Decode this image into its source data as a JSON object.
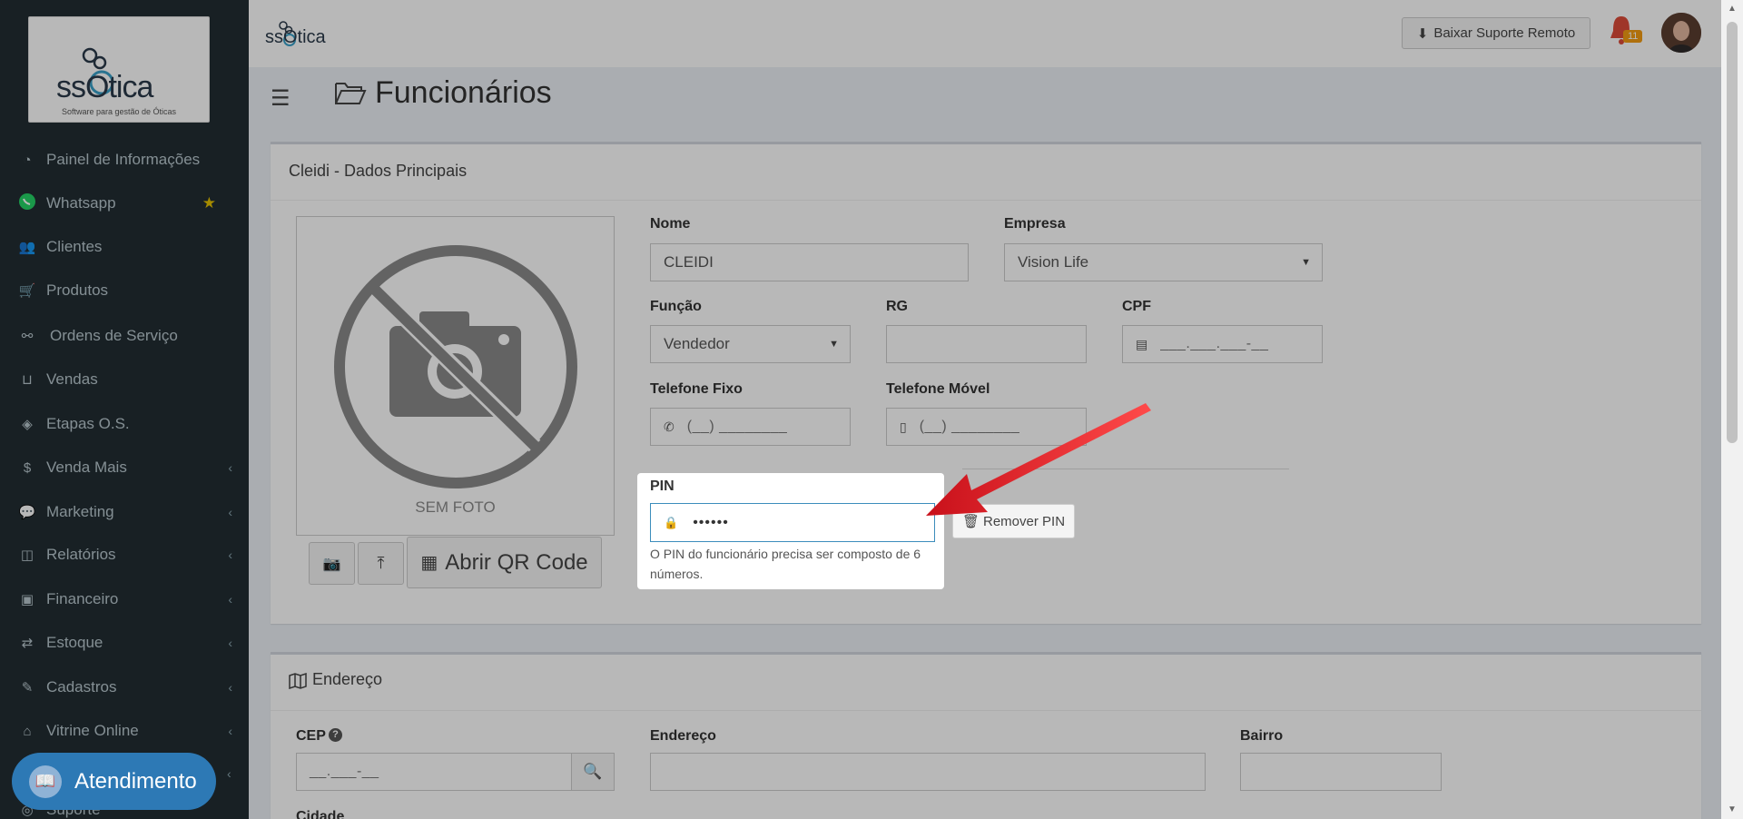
{
  "app": {
    "brand": "ssOtica",
    "tagline": "Software para gestão de Óticas"
  },
  "sidebar": {
    "items": [
      {
        "label": "Painel de Informações",
        "icon": "dashboard-icon"
      },
      {
        "label": "Whatsapp",
        "icon": "whatsapp-icon"
      },
      {
        "label": "Clientes",
        "icon": "users-icon"
      },
      {
        "label": "Produtos",
        "icon": "cart-icon"
      },
      {
        "label": "Ordens de Serviço",
        "icon": "glasses-icon"
      },
      {
        "label": "Vendas",
        "icon": "basket-icon"
      },
      {
        "label": "Etapas O.S.",
        "icon": "tag-icon"
      },
      {
        "label": "Venda Mais",
        "icon": "dollar-icon"
      },
      {
        "label": "Marketing",
        "icon": "comments-icon"
      },
      {
        "label": "Relatórios",
        "icon": "report-icon"
      },
      {
        "label": "Financeiro",
        "icon": "money-icon"
      },
      {
        "label": "Estoque",
        "icon": "exchange-icon"
      },
      {
        "label": "Cadastros",
        "icon": "edit-icon"
      },
      {
        "label": "Vitrine Online",
        "icon": "store-icon"
      },
      {
        "label": "Suporte",
        "icon": "support-icon"
      }
    ],
    "chat_button": "Atendimento"
  },
  "topbar": {
    "remote_support": "Baixar Suporte Remoto",
    "notifications_count": "11"
  },
  "page": {
    "title": "Funcionários"
  },
  "main_box": {
    "title": "Cleidi - Dados Principais",
    "photo_placeholder": "SEM FOTO",
    "qr_button": "Abrir QR Code",
    "fields": {
      "nome_label": "Nome",
      "nome_value": "CLEIDI",
      "empresa_label": "Empresa",
      "empresa_value": "Vision Life",
      "funcao_label": "Função",
      "funcao_value": "Vendedor",
      "rg_label": "RG",
      "rg_value": "",
      "cpf_label": "CPF",
      "cpf_mask": "___.___.___-__",
      "telefone_fixo_label": "Telefone Fixo",
      "telefone_fixo_mask": "(__) ________",
      "telefone_movel_label": "Telefone Móvel",
      "telefone_movel_mask": "(__) ________",
      "pin_label": "PIN",
      "pin_value": "••••••",
      "pin_help": "O PIN do funcionário precisa ser composto de 6 números.",
      "remove_pin": "Remover PIN"
    }
  },
  "address_box": {
    "title": "Endereço",
    "cep_label": "CEP",
    "cep_mask": "__.___-__",
    "endereco_label": "Endereço",
    "bairro_label": "Bairro",
    "cidade_label": "Cidade"
  },
  "colors": {
    "sidebar_bg": "#222d32",
    "accent_blue": "#3c8dbc",
    "chat_button": "#2d79b5",
    "arrow_red": "#e8141b",
    "badge": "#f39c12"
  }
}
